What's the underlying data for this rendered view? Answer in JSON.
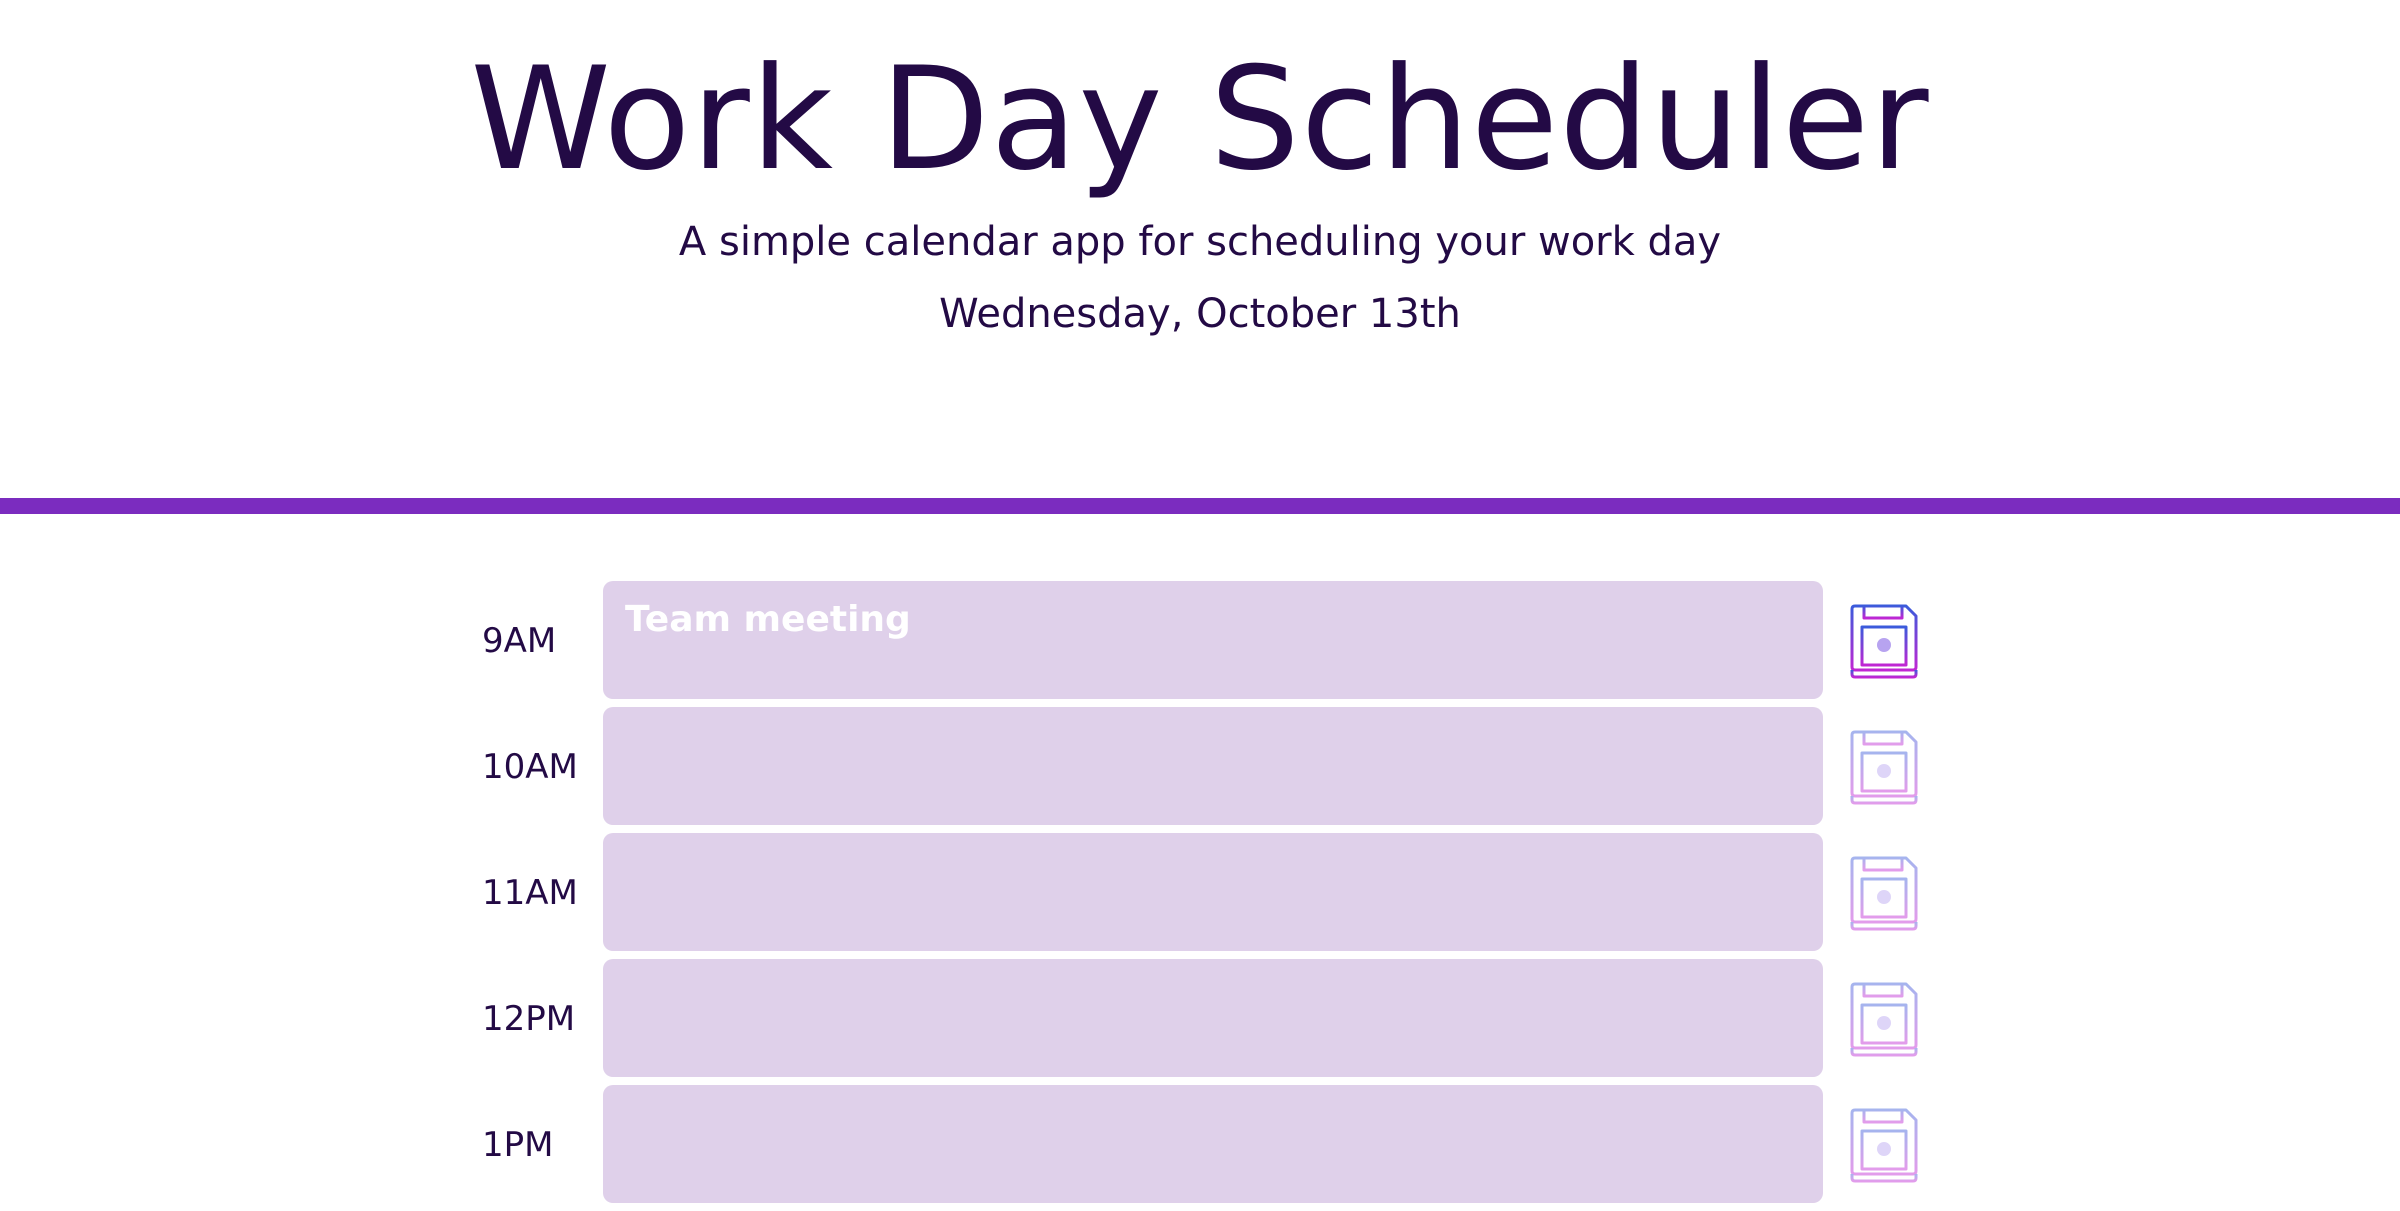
{
  "header": {
    "title": "Work Day Scheduler",
    "subtitle": "A simple calendar app for scheduling your work day",
    "date": "Wednesday, October 13th"
  },
  "colors": {
    "text": "#230a45",
    "divider": "#7b2cbf",
    "time_block": "#dfd0ea",
    "save_icon_start": "#3b5bdb",
    "save_icon_end": "#c026d3"
  },
  "schedule": {
    "rows": [
      {
        "hour": "9AM",
        "task": "Team meeting",
        "save_icon": "floppy-disk-icon"
      },
      {
        "hour": "10AM",
        "task": "",
        "save_icon": "floppy-disk-icon"
      },
      {
        "hour": "11AM",
        "task": "",
        "save_icon": "floppy-disk-icon"
      },
      {
        "hour": "12PM",
        "task": "",
        "save_icon": "floppy-disk-icon"
      },
      {
        "hour": "1PM",
        "task": "",
        "save_icon": "floppy-disk-icon"
      }
    ]
  }
}
